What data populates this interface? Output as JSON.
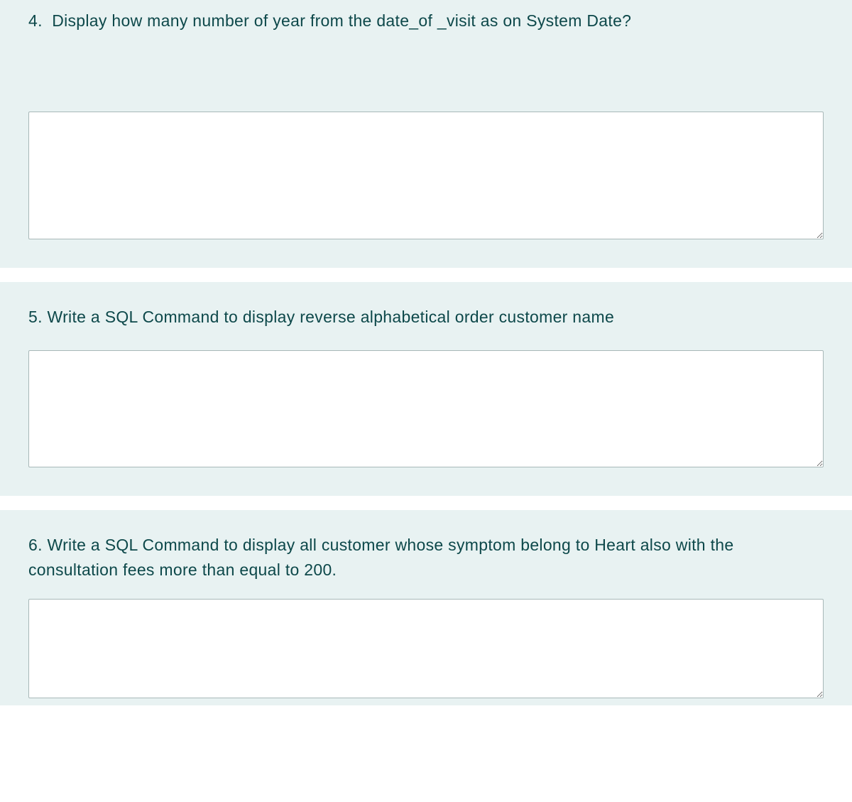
{
  "questions": [
    {
      "number": "4.",
      "text": "Display how many number of year from the date_of _visit as on System Date?",
      "answer": ""
    },
    {
      "number": "5.",
      "text": "Write a SQL Command to display reverse alphabetical order customer name",
      "answer": ""
    },
    {
      "number": "6.",
      "text": "Write  a SQL Command to display all customer whose symptom belong to Heart also with the consultation fees more than equal to 200.",
      "answer": ""
    }
  ]
}
